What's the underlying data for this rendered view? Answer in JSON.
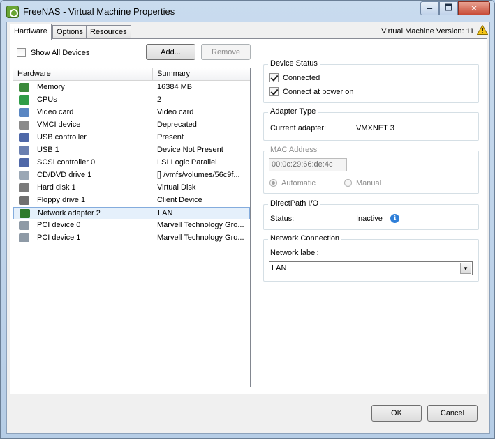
{
  "window": {
    "title": "FreeNAS - Virtual Machine Properties",
    "minimize_glyph": "🗕",
    "maximize_glyph": "🗖",
    "close_glyph": "✕"
  },
  "tabs": [
    {
      "label": "Hardware",
      "active": true
    },
    {
      "label": "Options",
      "active": false
    },
    {
      "label": "Resources",
      "active": false
    }
  ],
  "version_label": "Virtual Machine Version: 11",
  "hardware": {
    "show_all_label": "Show All Devices",
    "add_label": "Add...",
    "remove_label": "Remove",
    "col_hardware": "Hardware",
    "col_summary": "Summary",
    "rows": [
      {
        "icon": "memory-icon",
        "name": "Memory",
        "summary": "16384 MB",
        "color": "#3c8a3c"
      },
      {
        "icon": "cpu-icon",
        "name": "CPUs",
        "summary": "2",
        "color": "#2f9c47"
      },
      {
        "icon": "video-card-icon",
        "name": "Video card",
        "summary": "Video card",
        "color": "#5a86c2"
      },
      {
        "icon": "vmci-icon",
        "name": "VMCI device",
        "summary": "Deprecated",
        "color": "#8a8a8a"
      },
      {
        "icon": "usb-controller-icon",
        "name": "USB controller",
        "summary": "Present",
        "color": "#4f68a8"
      },
      {
        "icon": "usb-icon",
        "name": "USB 1",
        "summary": "Device Not Present",
        "color": "#6a7fb0"
      },
      {
        "icon": "scsi-icon",
        "name": "SCSI controller 0",
        "summary": "LSI Logic Parallel",
        "color": "#4f68a8"
      },
      {
        "icon": "cd-dvd-icon",
        "name": "CD/DVD drive 1",
        "summary": "[] /vmfs/volumes/56c9f...",
        "color": "#9aa7b5"
      },
      {
        "icon": "hard-disk-icon",
        "name": "Hard disk 1",
        "summary": "Virtual Disk",
        "color": "#7b7b7b"
      },
      {
        "icon": "floppy-icon",
        "name": "Floppy drive 1",
        "summary": "Client Device",
        "color": "#6f6f6f"
      },
      {
        "icon": "network-adapter-icon",
        "name": "Network adapter 2",
        "summary": "LAN",
        "color": "#2d7a2d"
      },
      {
        "icon": "pci-icon",
        "name": "PCI device 0",
        "summary": "Marvell Technology Gro...",
        "color": "#8e9aa6"
      },
      {
        "icon": "pci-icon",
        "name": "PCI device 1",
        "summary": "Marvell Technology Gro...",
        "color": "#8e9aa6"
      }
    ],
    "selected_index": 10
  },
  "device_status": {
    "title": "Device Status",
    "connected_label": "Connected",
    "connect_power_label": "Connect at power on"
  },
  "adapter_type": {
    "title": "Adapter Type",
    "current_label": "Current adapter:",
    "current_value": "VMXNET 3"
  },
  "mac": {
    "title": "MAC Address",
    "value": "00:0c:29:66:de:4c",
    "automatic_label": "Automatic",
    "manual_label": "Manual"
  },
  "directpath": {
    "title": "DirectPath I/O",
    "status_label": "Status:",
    "status_value": "Inactive",
    "info_glyph": "i"
  },
  "network": {
    "title": "Network Connection",
    "label": "Network label:",
    "value": "LAN",
    "arrow_glyph": "▼"
  },
  "footer": {
    "ok_label": "OK",
    "cancel_label": "Cancel"
  }
}
